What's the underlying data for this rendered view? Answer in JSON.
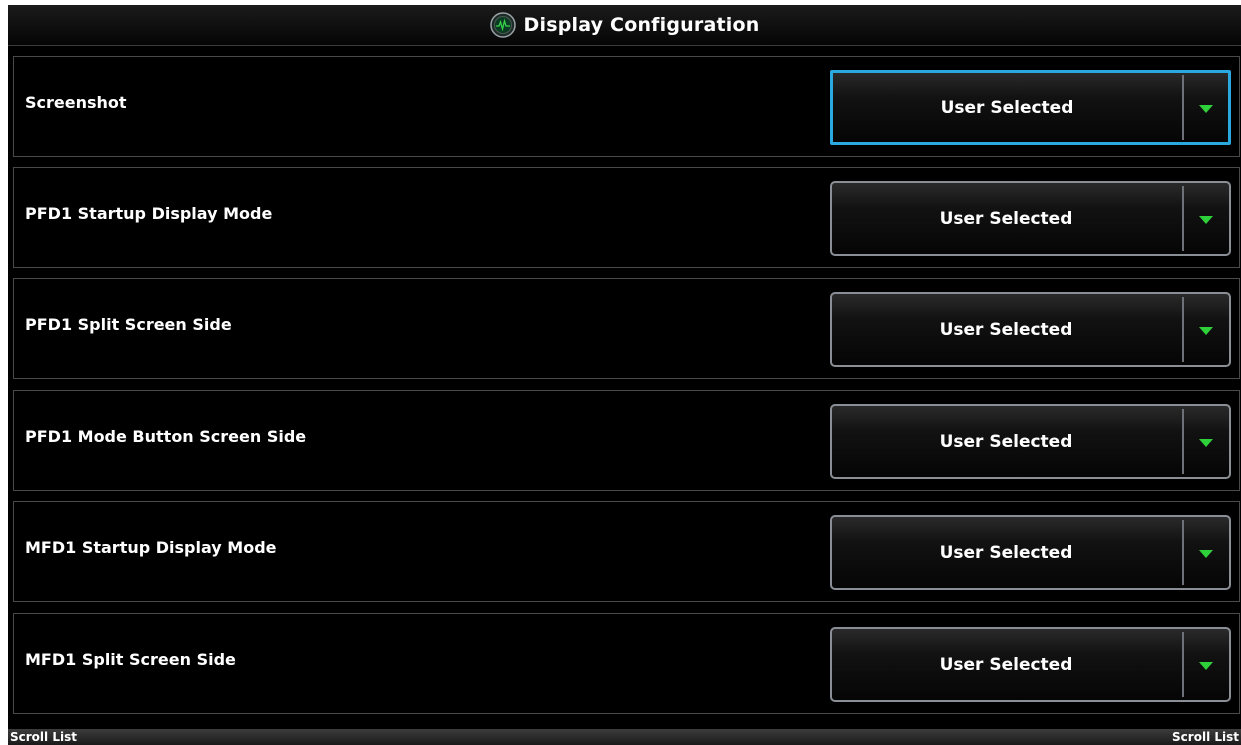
{
  "header": {
    "title": "Display Configuration",
    "icon": "display-configuration-icon"
  },
  "settings": [
    {
      "label": "Screenshot",
      "value": "User Selected",
      "focused": true
    },
    {
      "label": "PFD1 Startup Display Mode",
      "value": "User Selected",
      "focused": false
    },
    {
      "label": "PFD1 Split Screen Side",
      "value": "User Selected",
      "focused": false
    },
    {
      "label": "PFD1 Mode Button Screen Side",
      "value": "User Selected",
      "focused": false
    },
    {
      "label": "MFD1 Startup Display Mode",
      "value": "User Selected",
      "focused": false
    },
    {
      "label": "MFD1 Split Screen Side",
      "value": "User Selected",
      "focused": false
    }
  ],
  "footer": {
    "left_label": "Scroll List",
    "right_label": "Scroll List"
  },
  "colors": {
    "background": "#000000",
    "focus_border": "#2aa9e0",
    "dropdown_arrow": "#2fd13a",
    "text": "#ffffff"
  }
}
